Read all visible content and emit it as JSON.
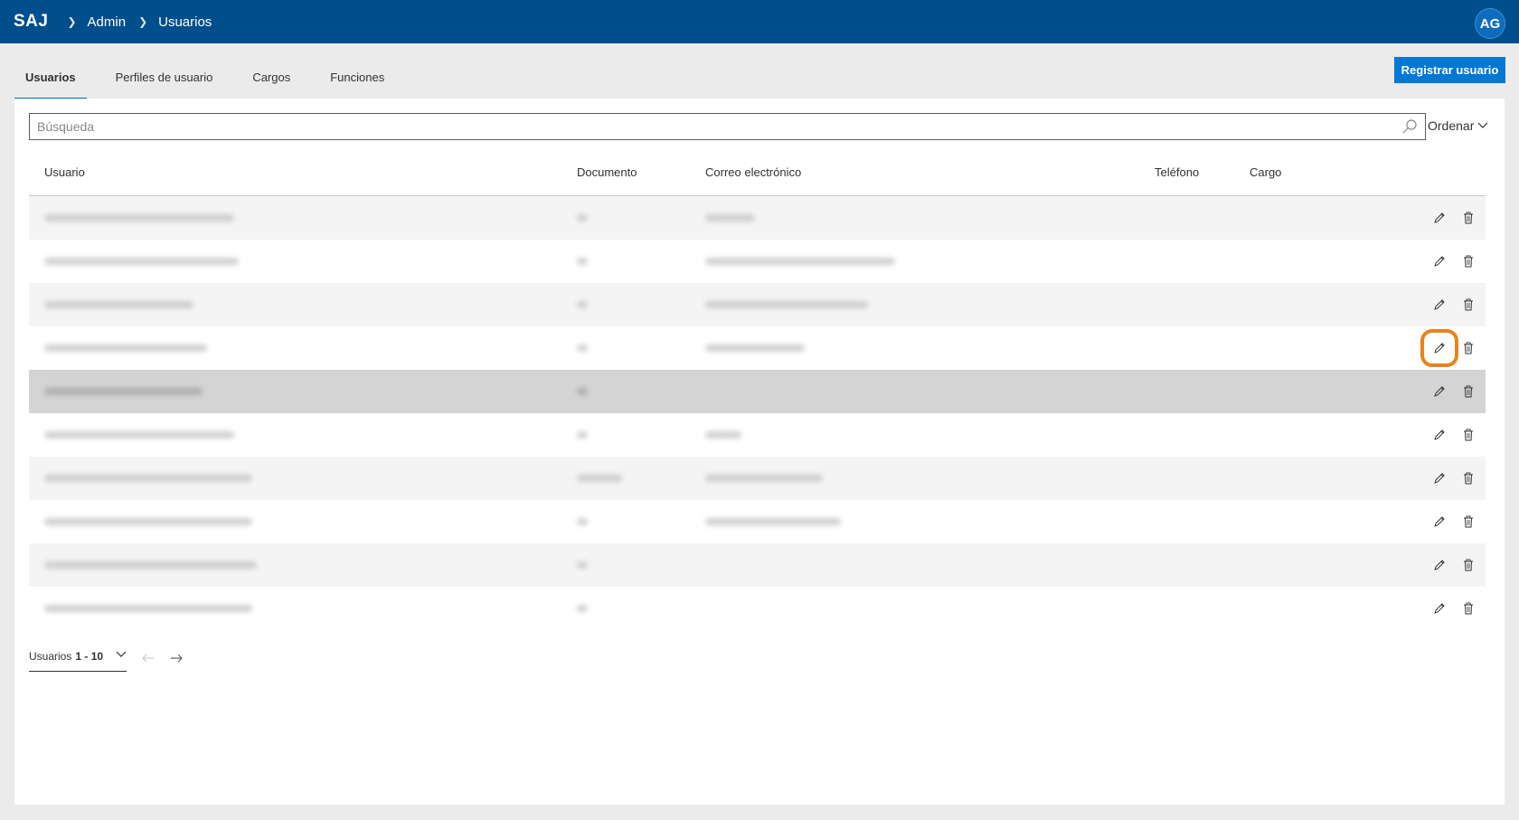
{
  "header": {
    "app_name": "SAJ",
    "breadcrumbs": [
      "Admin",
      "Usuarios"
    ],
    "avatar_initials": "AG",
    "brand_color": "#004e8c"
  },
  "tabs": [
    {
      "label": "Usuarios",
      "active": true
    },
    {
      "label": "Perfiles de usuario",
      "active": false
    },
    {
      "label": "Cargos",
      "active": false
    },
    {
      "label": "Funciones",
      "active": false
    }
  ],
  "register_button": {
    "label": "Registrar usuario"
  },
  "search": {
    "placeholder": "Búsqueda",
    "value": ""
  },
  "sort": {
    "label": "Ordenar"
  },
  "table": {
    "columns": [
      "Usuario",
      "Documento",
      "Correo electrónico",
      "Teléfono",
      "Cargo"
    ],
    "rows": [
      {
        "blurred": true,
        "selected": false,
        "has_email": true
      },
      {
        "blurred": true,
        "selected": false,
        "has_email": true
      },
      {
        "blurred": true,
        "selected": false,
        "has_email": true
      },
      {
        "blurred": true,
        "selected": false,
        "has_email": true,
        "edit_highlighted": true
      },
      {
        "blurred": true,
        "selected": true,
        "has_email": false
      },
      {
        "blurred": true,
        "selected": false,
        "has_email": true
      },
      {
        "blurred": true,
        "selected": false,
        "has_email": true
      },
      {
        "blurred": true,
        "selected": false,
        "has_email": true
      },
      {
        "blurred": true,
        "selected": false,
        "has_email": false
      },
      {
        "blurred": true,
        "selected": false,
        "has_email": false
      }
    ],
    "row_actions": [
      "pencil-icon",
      "trash-icon"
    ]
  },
  "pagination": {
    "label": "Usuarios",
    "range": "1 - 10"
  },
  "highlight_color": "#e8831c"
}
